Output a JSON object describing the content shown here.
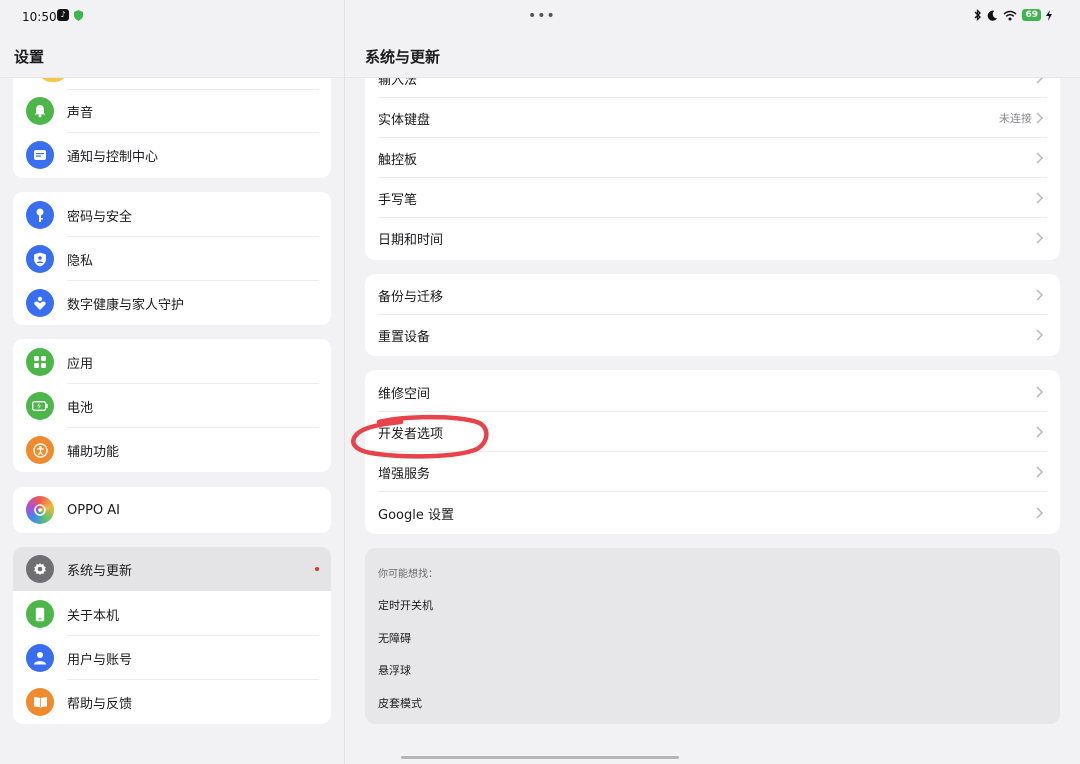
{
  "status": {
    "time": "10:50",
    "dots": "•••",
    "battery": "69"
  },
  "left": {
    "title": "设置",
    "groups": [
      {
        "items": [
          {
            "label": "声音",
            "icon": "bell-icon",
            "color": "#4cb648"
          },
          {
            "label": "通知与控制中心",
            "icon": "notification-icon",
            "color": "#3a6ef0"
          }
        ]
      },
      {
        "items": [
          {
            "label": "密码与安全",
            "icon": "key-icon",
            "color": "#3a6ef0"
          },
          {
            "label": "隐私",
            "icon": "privacy-icon",
            "color": "#3a6ef0"
          },
          {
            "label": "数字健康与家人守护",
            "icon": "wellbeing-icon",
            "color": "#3a6ef0"
          }
        ]
      },
      {
        "items": [
          {
            "label": "应用",
            "icon": "apps-icon",
            "color": "#4cb648"
          },
          {
            "label": "电池",
            "icon": "battery-icon",
            "color": "#4cb648"
          },
          {
            "label": "辅助功能",
            "icon": "accessibility-icon",
            "color": "#f08a2c"
          }
        ]
      },
      {
        "items": [
          {
            "label": "OPPO AI",
            "icon": "oppo-ai-icon",
            "color": "#b04ed6"
          }
        ]
      },
      {
        "items": [
          {
            "label": "系统与更新",
            "icon": "gear-icon",
            "color": "#6e6e73"
          },
          {
            "label": "关于本机",
            "icon": "phone-icon",
            "color": "#4cb648"
          },
          {
            "label": "用户与账号",
            "icon": "user-icon",
            "color": "#3a6ef0"
          },
          {
            "label": "帮助与反馈",
            "icon": "book-icon",
            "color": "#f08a2c"
          }
        ]
      }
    ]
  },
  "right": {
    "title": "系统与更新",
    "partial_label": "输入法",
    "group1": [
      {
        "label": "实体键盘",
        "value": "未连接"
      },
      {
        "label": "触控板"
      },
      {
        "label": "手写笔"
      },
      {
        "label": "日期和时间"
      }
    ],
    "group2": [
      {
        "label": "备份与迁移"
      },
      {
        "label": "重置设备"
      }
    ],
    "group3": [
      {
        "label": "维修空间"
      },
      {
        "label": "开发者选项"
      },
      {
        "label": "增强服务"
      },
      {
        "label": "Google 设置"
      }
    ],
    "suggest": {
      "header": "你可能想找：",
      "items": [
        "定时开关机",
        "无障碍",
        "悬浮球",
        "皮套模式"
      ]
    }
  },
  "colors": {
    "selection": "#e4e4e7",
    "annotation": "#e8424b",
    "update_dot": "#e0322d"
  }
}
